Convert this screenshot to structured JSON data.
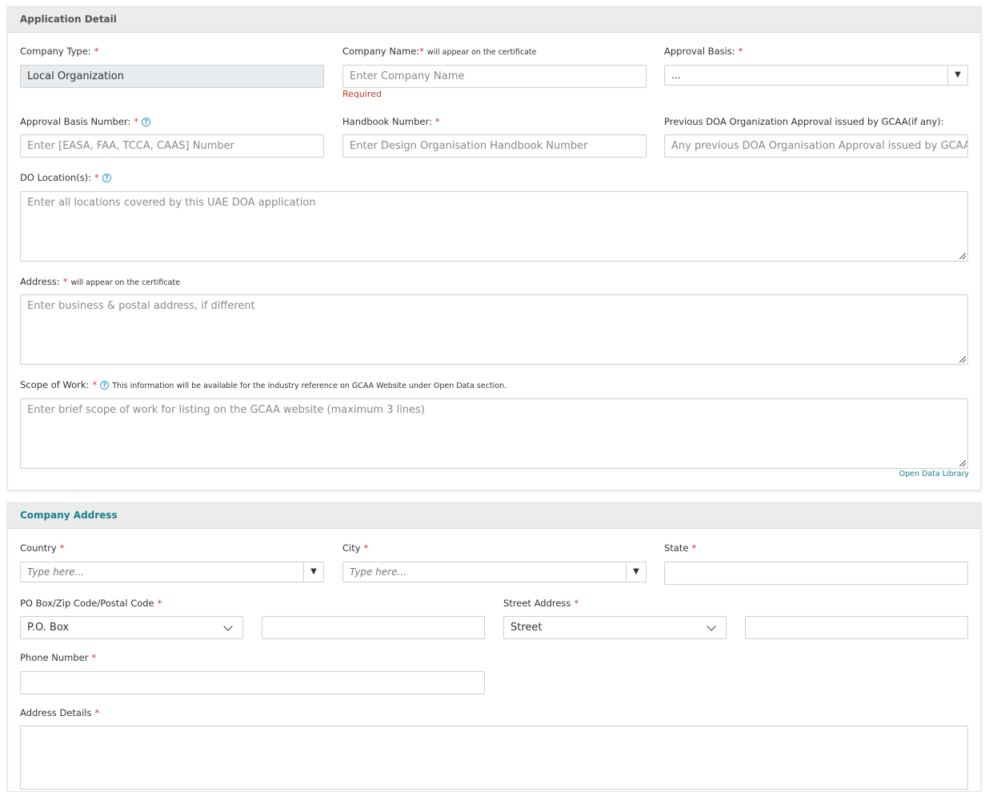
{
  "application_detail": {
    "title": "Application Detail",
    "company_type": {
      "label": "Company Type:",
      "value": "Local Organization"
    },
    "company_name": {
      "label": "Company Name:",
      "note": "will appear on the certificate",
      "placeholder": "Enter Company Name",
      "error": "Required"
    },
    "approval_basis": {
      "label": "Approval Basis:",
      "value": "..."
    },
    "approval_basis_number": {
      "label": "Approval Basis Number:",
      "placeholder": "Enter [EASA, FAA, TCCA, CAAS] Number"
    },
    "handbook_number": {
      "label": "Handbook Number:",
      "placeholder": "Enter Design Organisation Handbook Number"
    },
    "previous_doa": {
      "label": "Previous DOA Organization Approval issued by GCAA(if any):",
      "placeholder": "Any previous DOA Organisation Approval issued by GCAA"
    },
    "do_locations": {
      "label": "DO Location(s):",
      "placeholder": "Enter all locations covered by this UAE DOA application"
    },
    "address": {
      "label": "Address:",
      "note": "will appear on the certificate",
      "placeholder": "Enter business & postal address, if different"
    },
    "scope_of_work": {
      "label": "Scope of Work:",
      "note": "This information will be available for the industry reference on GCAA Website under Open Data section.",
      "placeholder": "Enter brief scope of work for listing on the GCAA website (maximum 3 lines)"
    },
    "open_data_link": "Open Data Library"
  },
  "company_address": {
    "title": "Company Address",
    "country": {
      "label": "Country",
      "placeholder": "Type here..."
    },
    "city": {
      "label": "City",
      "placeholder": "Type here..."
    },
    "state": {
      "label": "State",
      "value": ""
    },
    "po_box": {
      "label": "PO Box/Zip Code/Postal Code",
      "type_value": "P.O. Box",
      "value": ""
    },
    "street": {
      "label": "Street Address",
      "type_value": "Street",
      "value": ""
    },
    "phone": {
      "label": "Phone Number",
      "value": ""
    },
    "address_details": {
      "label": "Address Details",
      "value": ""
    }
  },
  "required_marker": "*",
  "help_icon_glyph": "?",
  "dropdown_arrow_glyph": "▼",
  "colors": {
    "accent": "#17808e",
    "required": "#d9343c",
    "help": "#2aa0c8"
  }
}
